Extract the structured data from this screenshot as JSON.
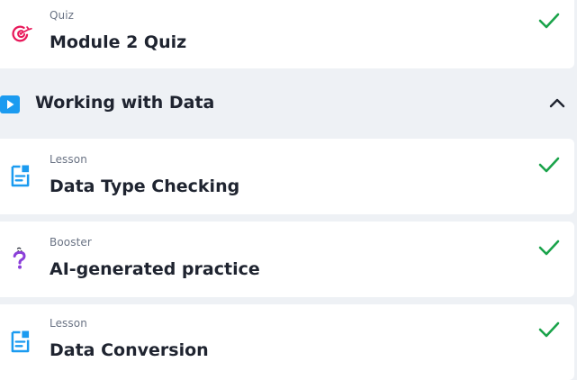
{
  "items_before": [
    {
      "type": "Quiz",
      "title": "Module 2 Quiz",
      "icon": "target-icon",
      "completed": true
    }
  ],
  "section": {
    "title": "Working with Data",
    "icon": "play-icon",
    "expanded": true,
    "toggle_icon": "chevron-up-icon"
  },
  "items": [
    {
      "type": "Lesson",
      "title": "Data Type Checking",
      "icon": "document-icon",
      "completed": true
    },
    {
      "type": "Booster",
      "title": "AI-generated practice",
      "icon": "question-icon",
      "completed": true
    },
    {
      "type": "Lesson",
      "title": "Data Conversion",
      "icon": "document-icon",
      "completed": true
    }
  ],
  "colors": {
    "check": "#1aa34a",
    "accent_blue": "#1b9bf0",
    "quiz_pink": "#e8185a",
    "booster_purple": "#8b3fd9"
  }
}
